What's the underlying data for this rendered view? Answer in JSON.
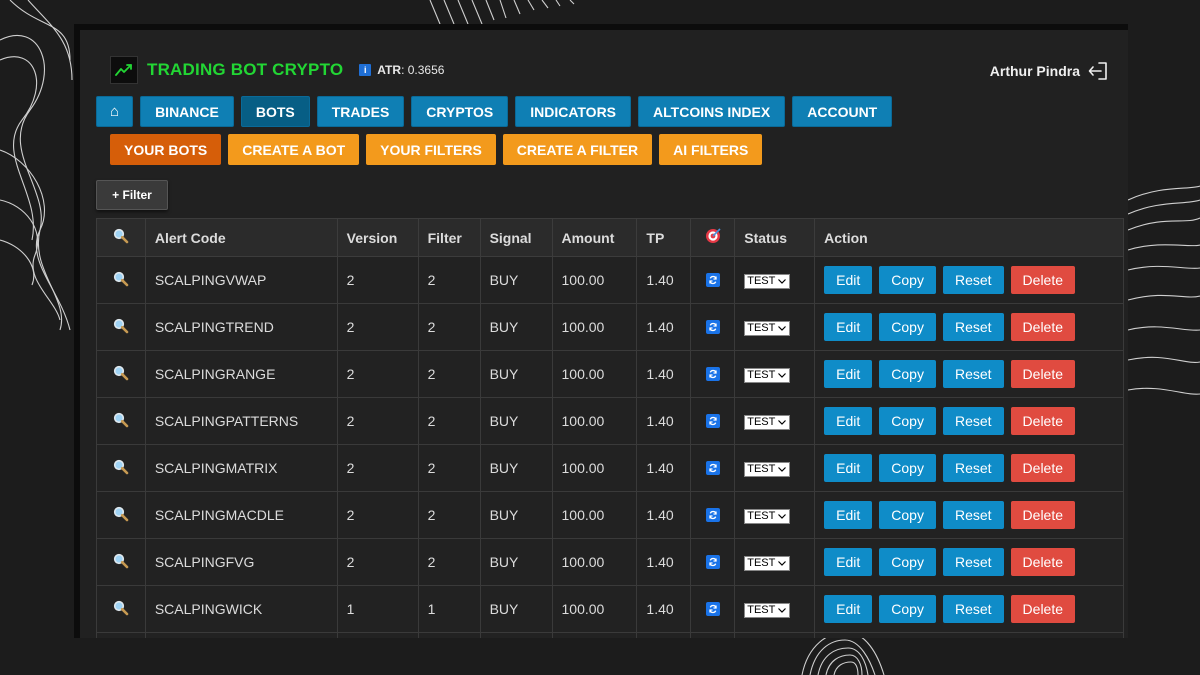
{
  "header": {
    "title": "TRADING BOT CRYPTO",
    "atr_label": "ATR",
    "atr_value": ": 0.3656",
    "info_icon": "i",
    "user_name": "Arthur Pindra"
  },
  "nav": {
    "home_glyph": "⌂",
    "main": [
      "BINANCE",
      "BOTS",
      "TRADES",
      "CRYPTOS",
      "INDICATORS",
      "ALTCOINS INDEX",
      "ACCOUNT"
    ],
    "sub": [
      "YOUR BOTS",
      "CREATE A BOT",
      "YOUR FILTERS",
      "CREATE A FILTER",
      "AI FILTERS"
    ]
  },
  "filter_button": "+ Filter",
  "table": {
    "headers": [
      "Alert Code",
      "Version",
      "Filter",
      "Signal",
      "Amount",
      "TP",
      "Status",
      "Action"
    ],
    "rows": [
      {
        "code": "SCALPINGVWAP",
        "version": "2",
        "filter": "2",
        "signal": "BUY",
        "amount": "100.00",
        "tp": "1.40",
        "status": "TEST"
      },
      {
        "code": "SCALPINGTREND",
        "version": "2",
        "filter": "2",
        "signal": "BUY",
        "amount": "100.00",
        "tp": "1.40",
        "status": "TEST"
      },
      {
        "code": "SCALPINGRANGE",
        "version": "2",
        "filter": "2",
        "signal": "BUY",
        "amount": "100.00",
        "tp": "1.40",
        "status": "TEST"
      },
      {
        "code": "SCALPINGPATTERNS",
        "version": "2",
        "filter": "2",
        "signal": "BUY",
        "amount": "100.00",
        "tp": "1.40",
        "status": "TEST"
      },
      {
        "code": "SCALPINGMATRIX",
        "version": "2",
        "filter": "2",
        "signal": "BUY",
        "amount": "100.00",
        "tp": "1.40",
        "status": "TEST"
      },
      {
        "code": "SCALPINGMACDLE",
        "version": "2",
        "filter": "2",
        "signal": "BUY",
        "amount": "100.00",
        "tp": "1.40",
        "status": "TEST"
      },
      {
        "code": "SCALPINGFVG",
        "version": "2",
        "filter": "2",
        "signal": "BUY",
        "amount": "100.00",
        "tp": "1.40",
        "status": "TEST"
      },
      {
        "code": "SCALPINGWICK",
        "version": "1",
        "filter": "1",
        "signal": "BUY",
        "amount": "100.00",
        "tp": "1.40",
        "status": "TEST"
      }
    ],
    "actions": {
      "edit": "Edit",
      "copy": "Copy",
      "reset": "Reset",
      "delete": "Delete"
    }
  },
  "colors": {
    "brand_green": "#22d634",
    "nav_blue": "#0f7fb4",
    "nav_orange": "#f39a1c",
    "nav_orange_active": "#d65e09",
    "delete_red": "#e04b40"
  },
  "icons": {
    "brand": "trend-up-icon",
    "search": "magnifier-icon",
    "target": "target-icon",
    "sync": "refresh-icon",
    "logout": "logout-icon"
  }
}
